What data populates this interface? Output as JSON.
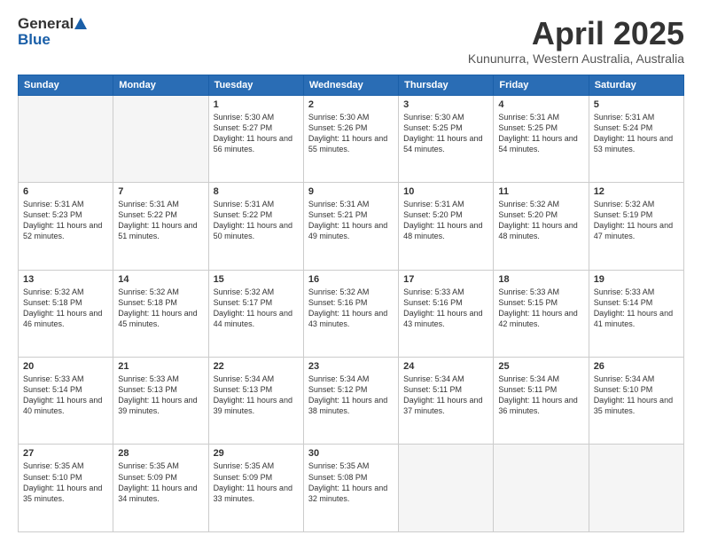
{
  "header": {
    "logo_general": "General",
    "logo_blue": "Blue",
    "title": "April 2025",
    "location": "Kununurra, Western Australia, Australia"
  },
  "weekdays": [
    "Sunday",
    "Monday",
    "Tuesday",
    "Wednesday",
    "Thursday",
    "Friday",
    "Saturday"
  ],
  "weeks": [
    [
      {
        "day": "",
        "empty": true
      },
      {
        "day": "",
        "empty": true
      },
      {
        "day": "1",
        "sunrise": "Sunrise: 5:30 AM",
        "sunset": "Sunset: 5:27 PM",
        "daylight": "Daylight: 11 hours and 56 minutes."
      },
      {
        "day": "2",
        "sunrise": "Sunrise: 5:30 AM",
        "sunset": "Sunset: 5:26 PM",
        "daylight": "Daylight: 11 hours and 55 minutes."
      },
      {
        "day": "3",
        "sunrise": "Sunrise: 5:30 AM",
        "sunset": "Sunset: 5:25 PM",
        "daylight": "Daylight: 11 hours and 54 minutes."
      },
      {
        "day": "4",
        "sunrise": "Sunrise: 5:31 AM",
        "sunset": "Sunset: 5:25 PM",
        "daylight": "Daylight: 11 hours and 54 minutes."
      },
      {
        "day": "5",
        "sunrise": "Sunrise: 5:31 AM",
        "sunset": "Sunset: 5:24 PM",
        "daylight": "Daylight: 11 hours and 53 minutes."
      }
    ],
    [
      {
        "day": "6",
        "sunrise": "Sunrise: 5:31 AM",
        "sunset": "Sunset: 5:23 PM",
        "daylight": "Daylight: 11 hours and 52 minutes."
      },
      {
        "day": "7",
        "sunrise": "Sunrise: 5:31 AM",
        "sunset": "Sunset: 5:22 PM",
        "daylight": "Daylight: 11 hours and 51 minutes."
      },
      {
        "day": "8",
        "sunrise": "Sunrise: 5:31 AM",
        "sunset": "Sunset: 5:22 PM",
        "daylight": "Daylight: 11 hours and 50 minutes."
      },
      {
        "day": "9",
        "sunrise": "Sunrise: 5:31 AM",
        "sunset": "Sunset: 5:21 PM",
        "daylight": "Daylight: 11 hours and 49 minutes."
      },
      {
        "day": "10",
        "sunrise": "Sunrise: 5:31 AM",
        "sunset": "Sunset: 5:20 PM",
        "daylight": "Daylight: 11 hours and 48 minutes."
      },
      {
        "day": "11",
        "sunrise": "Sunrise: 5:32 AM",
        "sunset": "Sunset: 5:20 PM",
        "daylight": "Daylight: 11 hours and 48 minutes."
      },
      {
        "day": "12",
        "sunrise": "Sunrise: 5:32 AM",
        "sunset": "Sunset: 5:19 PM",
        "daylight": "Daylight: 11 hours and 47 minutes."
      }
    ],
    [
      {
        "day": "13",
        "sunrise": "Sunrise: 5:32 AM",
        "sunset": "Sunset: 5:18 PM",
        "daylight": "Daylight: 11 hours and 46 minutes."
      },
      {
        "day": "14",
        "sunrise": "Sunrise: 5:32 AM",
        "sunset": "Sunset: 5:18 PM",
        "daylight": "Daylight: 11 hours and 45 minutes."
      },
      {
        "day": "15",
        "sunrise": "Sunrise: 5:32 AM",
        "sunset": "Sunset: 5:17 PM",
        "daylight": "Daylight: 11 hours and 44 minutes."
      },
      {
        "day": "16",
        "sunrise": "Sunrise: 5:32 AM",
        "sunset": "Sunset: 5:16 PM",
        "daylight": "Daylight: 11 hours and 43 minutes."
      },
      {
        "day": "17",
        "sunrise": "Sunrise: 5:33 AM",
        "sunset": "Sunset: 5:16 PM",
        "daylight": "Daylight: 11 hours and 43 minutes."
      },
      {
        "day": "18",
        "sunrise": "Sunrise: 5:33 AM",
        "sunset": "Sunset: 5:15 PM",
        "daylight": "Daylight: 11 hours and 42 minutes."
      },
      {
        "day": "19",
        "sunrise": "Sunrise: 5:33 AM",
        "sunset": "Sunset: 5:14 PM",
        "daylight": "Daylight: 11 hours and 41 minutes."
      }
    ],
    [
      {
        "day": "20",
        "sunrise": "Sunrise: 5:33 AM",
        "sunset": "Sunset: 5:14 PM",
        "daylight": "Daylight: 11 hours and 40 minutes."
      },
      {
        "day": "21",
        "sunrise": "Sunrise: 5:33 AM",
        "sunset": "Sunset: 5:13 PM",
        "daylight": "Daylight: 11 hours and 39 minutes."
      },
      {
        "day": "22",
        "sunrise": "Sunrise: 5:34 AM",
        "sunset": "Sunset: 5:13 PM",
        "daylight": "Daylight: 11 hours and 39 minutes."
      },
      {
        "day": "23",
        "sunrise": "Sunrise: 5:34 AM",
        "sunset": "Sunset: 5:12 PM",
        "daylight": "Daylight: 11 hours and 38 minutes."
      },
      {
        "day": "24",
        "sunrise": "Sunrise: 5:34 AM",
        "sunset": "Sunset: 5:11 PM",
        "daylight": "Daylight: 11 hours and 37 minutes."
      },
      {
        "day": "25",
        "sunrise": "Sunrise: 5:34 AM",
        "sunset": "Sunset: 5:11 PM",
        "daylight": "Daylight: 11 hours and 36 minutes."
      },
      {
        "day": "26",
        "sunrise": "Sunrise: 5:34 AM",
        "sunset": "Sunset: 5:10 PM",
        "daylight": "Daylight: 11 hours and 35 minutes."
      }
    ],
    [
      {
        "day": "27",
        "sunrise": "Sunrise: 5:35 AM",
        "sunset": "Sunset: 5:10 PM",
        "daylight": "Daylight: 11 hours and 35 minutes."
      },
      {
        "day": "28",
        "sunrise": "Sunrise: 5:35 AM",
        "sunset": "Sunset: 5:09 PM",
        "daylight": "Daylight: 11 hours and 34 minutes."
      },
      {
        "day": "29",
        "sunrise": "Sunrise: 5:35 AM",
        "sunset": "Sunset: 5:09 PM",
        "daylight": "Daylight: 11 hours and 33 minutes."
      },
      {
        "day": "30",
        "sunrise": "Sunrise: 5:35 AM",
        "sunset": "Sunset: 5:08 PM",
        "daylight": "Daylight: 11 hours and 32 minutes."
      },
      {
        "day": "",
        "empty": true
      },
      {
        "day": "",
        "empty": true
      },
      {
        "day": "",
        "empty": true
      }
    ]
  ]
}
